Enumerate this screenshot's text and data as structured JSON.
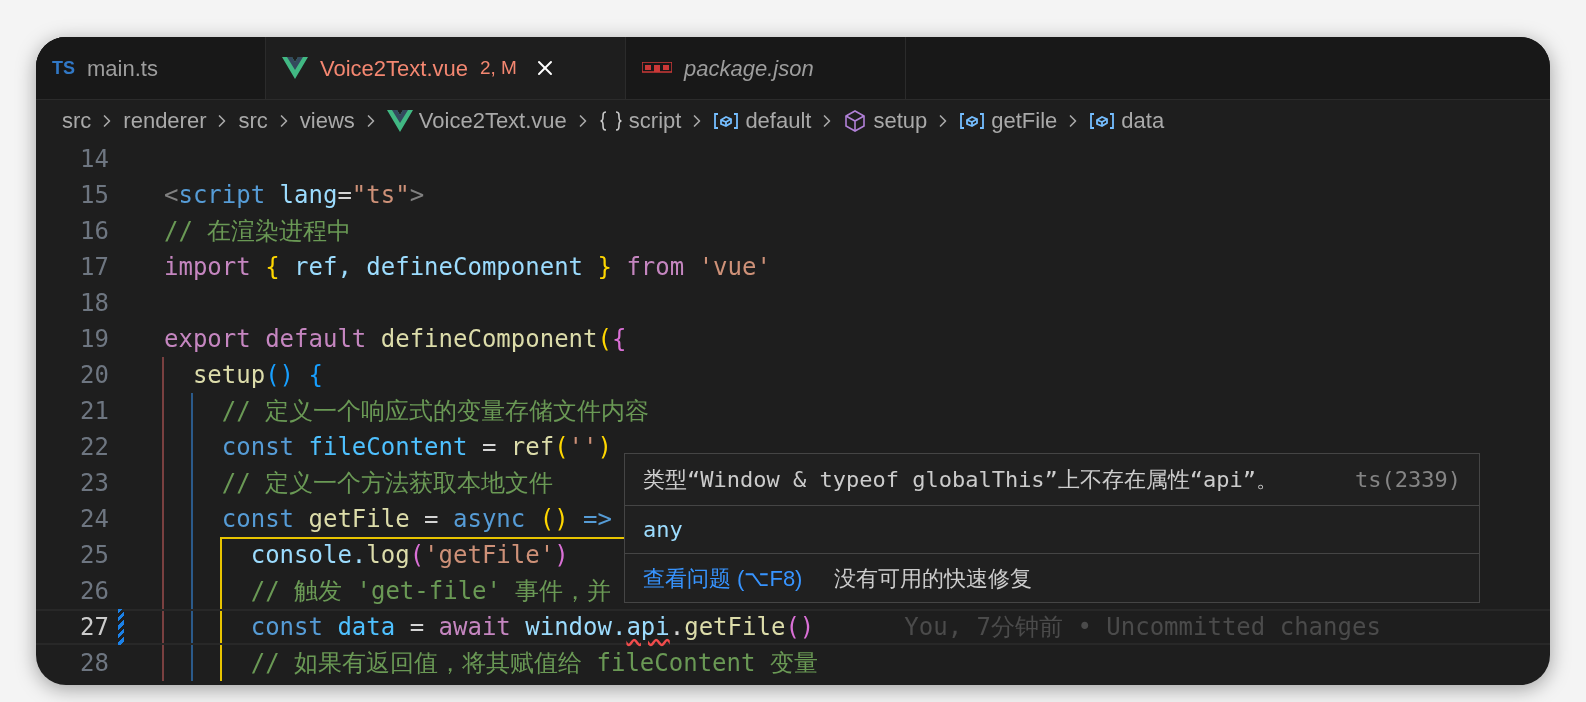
{
  "tabs": [
    {
      "label": "main.ts",
      "kind": "ts",
      "icon_text": "TS",
      "selected": false,
      "preview": false,
      "errors": false
    },
    {
      "label": "Voice2Text.vue",
      "kind": "vue",
      "selected": true,
      "preview": false,
      "errors": true,
      "badge": "2, M"
    },
    {
      "label": "package.json",
      "kind": "npm",
      "selected": false,
      "preview": true,
      "errors": false
    }
  ],
  "breadcrumb": [
    {
      "label": "src",
      "kind": "folder"
    },
    {
      "label": "renderer",
      "kind": "folder"
    },
    {
      "label": "src",
      "kind": "folder"
    },
    {
      "label": "views",
      "kind": "folder"
    },
    {
      "label": "Voice2Text.vue",
      "kind": "vue"
    },
    {
      "label": "script",
      "kind": "braces"
    },
    {
      "label": "default",
      "kind": "variable"
    },
    {
      "label": "setup",
      "kind": "method"
    },
    {
      "label": "getFile",
      "kind": "variable"
    },
    {
      "label": "data",
      "kind": "variable"
    }
  ],
  "lines": [
    {
      "number": "14"
    },
    {
      "number": "15",
      "tokens": [
        {
          "kind": "punct",
          "text": "<"
        },
        {
          "kind": "tag",
          "text": "script "
        },
        {
          "kind": "attr",
          "text": "lang"
        },
        {
          "kind": "plain",
          "text": "="
        },
        {
          "kind": "string",
          "text": "\"ts\""
        },
        {
          "kind": "punct",
          "text": ">"
        }
      ]
    },
    {
      "number": "16",
      "tokens": [
        {
          "kind": "comment",
          "text": "// 在渲染进程中"
        }
      ]
    },
    {
      "number": "17",
      "tokens": [
        {
          "kind": "keyword",
          "text": "import "
        },
        {
          "kind": "bracket1",
          "text": "{ "
        },
        {
          "kind": "variable",
          "text": "ref, defineComponent "
        },
        {
          "kind": "bracket1",
          "text": "} "
        },
        {
          "kind": "keyword",
          "text": "from "
        },
        {
          "kind": "string",
          "text": "'vue'"
        }
      ]
    },
    {
      "number": "18"
    },
    {
      "number": "19",
      "tokens": [
        {
          "kind": "keyword",
          "text": "export default "
        },
        {
          "kind": "function",
          "text": "defineComponent"
        },
        {
          "kind": "bracket1",
          "text": "("
        },
        {
          "kind": "bracket2",
          "text": "{"
        }
      ]
    },
    {
      "number": "20",
      "tokens": [
        {
          "kind": "function",
          "text": "  setup"
        },
        {
          "kind": "bracket3",
          "text": "() {"
        }
      ]
    },
    {
      "number": "21",
      "tokens": [
        {
          "kind": "comment",
          "text": "    // 定义一个响应式的变量存储文件内容"
        }
      ]
    },
    {
      "number": "22",
      "tokens": [
        {
          "kind": "storage",
          "text": "    const "
        },
        {
          "kind": "constant",
          "text": "fileContent "
        },
        {
          "kind": "plain",
          "text": "= "
        },
        {
          "kind": "function",
          "text": "ref"
        },
        {
          "kind": "bracket1",
          "text": "("
        },
        {
          "kind": "string",
          "text": "''"
        },
        {
          "kind": "bracket1",
          "text": ")"
        }
      ]
    },
    {
      "number": "23",
      "tokens": [
        {
          "kind": "comment",
          "text": "    // 定义一个方法获取本地文件"
        }
      ]
    },
    {
      "number": "24",
      "tokens": [
        {
          "kind": "storage",
          "text": "    const "
        },
        {
          "kind": "function",
          "text": "getFile "
        },
        {
          "kind": "plain",
          "text": "= "
        },
        {
          "kind": "storage",
          "text": "async "
        },
        {
          "kind": "bracket1",
          "text": "() "
        },
        {
          "kind": "storage",
          "text": "=>"
        }
      ]
    },
    {
      "number": "25",
      "tokens": [
        {
          "kind": "variable",
          "text": "      console."
        },
        {
          "kind": "function",
          "text": "log"
        },
        {
          "kind": "bracket2",
          "text": "("
        },
        {
          "kind": "string",
          "text": "'getFile'"
        },
        {
          "kind": "bracket2",
          "text": ")"
        }
      ]
    },
    {
      "number": "26",
      "tokens": [
        {
          "kind": "comment",
          "text": "      // 触发 'get-file' 事件，并"
        }
      ]
    },
    {
      "number": "27",
      "current": true,
      "modified": true,
      "blame": "You, 7分钟前 • Uncommitted changes",
      "tokens": [
        {
          "kind": "storage",
          "text": "      const "
        },
        {
          "kind": "constant",
          "text": "data "
        },
        {
          "kind": "plain",
          "text": "= "
        },
        {
          "kind": "keyword",
          "text": "await "
        },
        {
          "kind": "variable",
          "text": "window."
        },
        {
          "kind": "variable",
          "text": "api",
          "error": true
        },
        {
          "kind": "plain",
          "text": "."
        },
        {
          "kind": "function",
          "text": "getFile"
        },
        {
          "kind": "bracket2",
          "text": "()"
        }
      ]
    },
    {
      "number": "28",
      "tokens": [
        {
          "kind": "comment",
          "text": "      // 如果有返回值，将其赋值给 fileContent 变量"
        }
      ]
    }
  ],
  "hover": {
    "message": "类型“Window & typeof globalThis”上不存在属性“api”。",
    "code": "ts(2339)",
    "type": "any",
    "actions": [
      {
        "kind": "link",
        "label": "查看问题 (⌥F8)"
      },
      {
        "kind": "text",
        "label": "没有可用的快速修复"
      }
    ]
  }
}
